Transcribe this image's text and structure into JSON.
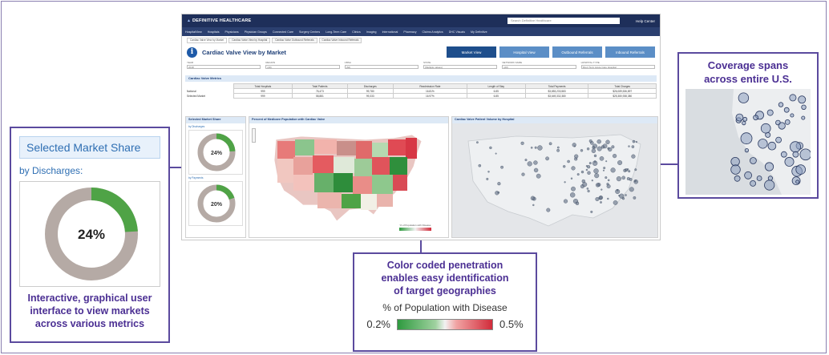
{
  "callouts": {
    "market": {
      "title": "Selected Market Share",
      "subtitle": "by Discharges:",
      "donut_value": "24%",
      "donut_fraction": 0.24,
      "caption_lines": [
        "Interactive, graphical user",
        "interface to view markets",
        "across various metrics"
      ]
    },
    "coverage": {
      "caption_lines": [
        "Coverage spans",
        "across entire U.S."
      ]
    },
    "color": {
      "caption_lines": [
        "Color coded penetration",
        "enables easy identification",
        "of target geographies"
      ],
      "legend_title": "% of Population with Disease",
      "legend_min": "0.2%",
      "legend_max": "0.5%"
    }
  },
  "dashboard": {
    "brand": "DEFINITIVE HEALTHCARE",
    "search_placeholder": "Search Definitive Healthcare",
    "help": "Help Center",
    "nav": [
      "HospitalView",
      "Hospitals",
      "Physicians",
      "Physician Groups",
      "Connected Care",
      "Surgery Centers",
      "Long-Term Care",
      "Clinics",
      "Imaging",
      "International",
      "Pharmacy",
      "Claims Analytics",
      "DHC Visuals",
      "My Definitive"
    ],
    "tabs": [
      "Cardiac Valve View by Market",
      "Cardiac Valve View by Hospital",
      "Cardiac Valve Outbound Referrals",
      "Cardiac Valve Inbound Referrals"
    ],
    "title": "Cardiac Valve View by Market",
    "view_buttons": [
      "Market View",
      "Hospital View",
      "Outbound Referrals",
      "Inbound Referrals"
    ],
    "filters": [
      {
        "label": "YEAR",
        "value": "2018"
      },
      {
        "label": "REGION",
        "value": "(All)"
      },
      {
        "label": "CBSA",
        "value": "(All)"
      },
      {
        "label": "STATE",
        "value": "(Multiple values)"
      },
      {
        "label": "NETWORK NAME",
        "value": "(All)"
      },
      {
        "label": "HOSPITAL TYPE",
        "value": "Short Term Acute Care Hospital"
      }
    ],
    "metrics_title": "Cardiac Valve Metrics",
    "metrics_headers": [
      "Total Hospitals",
      "Total Patients",
      "Discharges",
      "Readmission Rate",
      "Length of Stay",
      "Total Payments",
      "Total Charges"
    ],
    "metrics_rows": [
      {
        "label": "National",
        "values": [
          "999",
          "76,473",
          "99,780",
          "16.81%",
          "6.85",
          "$3,853,233,583",
          "$26,089,536,897"
        ]
      },
      {
        "label": "Selected Market",
        "values": [
          "999",
          "58,881",
          "99,333",
          "16.97%",
          "6.85",
          "$3,649,332,380",
          "$25,380,938,380"
        ]
      }
    ],
    "market_share_title": "Selected Market Share",
    "market_share_by_discharges": "by Discharges",
    "market_share_by_payments": "by Payments",
    "donut1": "24%",
    "donut1_fraction": 0.24,
    "donut2": "20%",
    "donut2_fraction": 0.2,
    "map1_title": "Percent of Medicare Population with Cardiac Valve",
    "map1_legend": "% of Population with Disease",
    "map2_title": "Cardiac Valve Patient Volume by Hospital"
  },
  "colors": {
    "accent_purple": "#4b2f93",
    "donut_green": "#4fa346",
    "donut_gray": "#b5aaa5",
    "legend_low": "#2e9a3f",
    "legend_high": "#d12b3a"
  }
}
